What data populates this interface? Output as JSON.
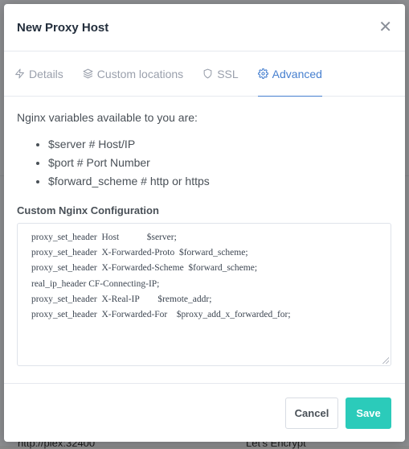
{
  "background": {
    "fragment_url": "http://plex:32400",
    "fragment_ssl": "Let's Encrypt"
  },
  "modal": {
    "title": "New Proxy Host",
    "close_icon": "close-icon"
  },
  "tabs": [
    {
      "label": "Details",
      "icon": "lightning-icon",
      "active": false
    },
    {
      "label": "Custom locations",
      "icon": "layers-icon",
      "active": false
    },
    {
      "label": "SSL",
      "icon": "shield-icon",
      "active": false
    },
    {
      "label": "Advanced",
      "icon": "gear-icon",
      "active": true
    }
  ],
  "advanced": {
    "intro": "Nginx variables available to you are:",
    "variables": [
      "$server # Host/IP",
      "$port # Port Number",
      "$forward_scheme # http or https"
    ],
    "config_label": "Custom Nginx Configuration",
    "config_lines": [
      "proxy_set_header  Host            $server;",
      "proxy_set_header  X-Forwarded-Proto  $forward_scheme;",
      "proxy_set_header  X-Forwarded-Scheme  $forward_scheme;",
      "real_ip_header CF-Connecting-IP;",
      "proxy_set_header  X-Real-IP        $remote_addr;",
      "proxy_set_header  X-Forwarded-For    $proxy_add_x_forwarded_for;"
    ]
  },
  "footer": {
    "cancel_label": "Cancel",
    "save_label": "Save"
  },
  "colors": {
    "accent": "#467fcf",
    "save": "#2bcbba"
  }
}
